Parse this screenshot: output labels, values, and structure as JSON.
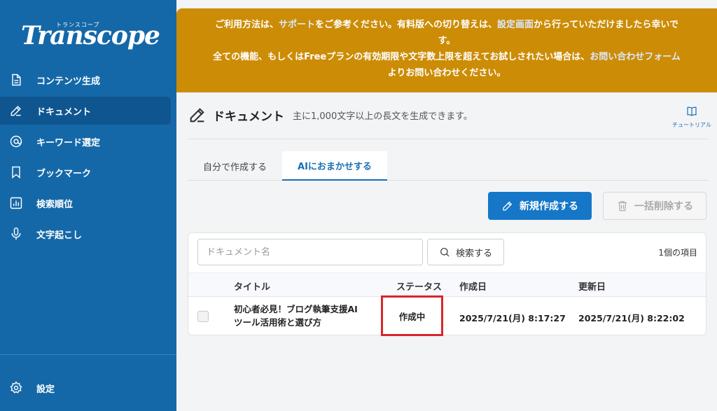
{
  "sidebar": {
    "logo_sub": "トランスコープ",
    "logo_main": "Transcope",
    "items": [
      {
        "label": "コンテンツ生成",
        "icon": "document-icon"
      },
      {
        "label": "ドキュメント",
        "icon": "edit-icon",
        "active": true
      },
      {
        "label": "キーワード選定",
        "icon": "at-icon"
      },
      {
        "label": "ブックマーク",
        "icon": "bookmark-icon"
      },
      {
        "label": "検索順位",
        "icon": "chart-icon"
      },
      {
        "label": "文字起こし",
        "icon": "mic-icon"
      }
    ],
    "settings_label": "設定"
  },
  "banner": {
    "line1_a": "ご利用方法は、",
    "line1_link1": "サポート",
    "line1_b": "をご参考ください。有料版への切り替えは、",
    "line1_link2": "設定画面",
    "line1_c": "から行っていただけましたら幸いで",
    "line2": "す。",
    "line3_a": "全ての機能、もしくはFreeプランの有効期限や文字数上限を超えてお試しされたい場合は、",
    "line3_link": "お問い合わせフォーム",
    "line4": "よりお問い合わせください。"
  },
  "header": {
    "title": "ドキュメント",
    "description": "主に1,000文字以上の長文を生成できます。",
    "tutorial_label": "チュートリアル"
  },
  "tabs": [
    {
      "label": "自分で作成する",
      "active": false
    },
    {
      "label": "AIにおまかせする",
      "active": true
    }
  ],
  "actions": {
    "new_label": "新規作成する",
    "delete_label": "一括削除する"
  },
  "search": {
    "placeholder": "ドキュメント名",
    "value": "",
    "button_label": "検索する",
    "count_label": "1個の項目"
  },
  "table": {
    "columns": [
      "タイトル",
      "ステータス",
      "作成日",
      "更新日"
    ],
    "rows": [
      {
        "title_line1": "初心者必見！ブログ執筆支援AI",
        "title_line2": "ツール活用術と選び方",
        "status": "作成中",
        "created": "2025/7/21(月) 8:17:27",
        "updated": "2025/7/21(月) 8:22:02"
      }
    ]
  },
  "colors": {
    "sidebar": "#1568a8",
    "banner": "#cc8c06",
    "accent": "#1677c8",
    "highlight": "#d9262a"
  }
}
